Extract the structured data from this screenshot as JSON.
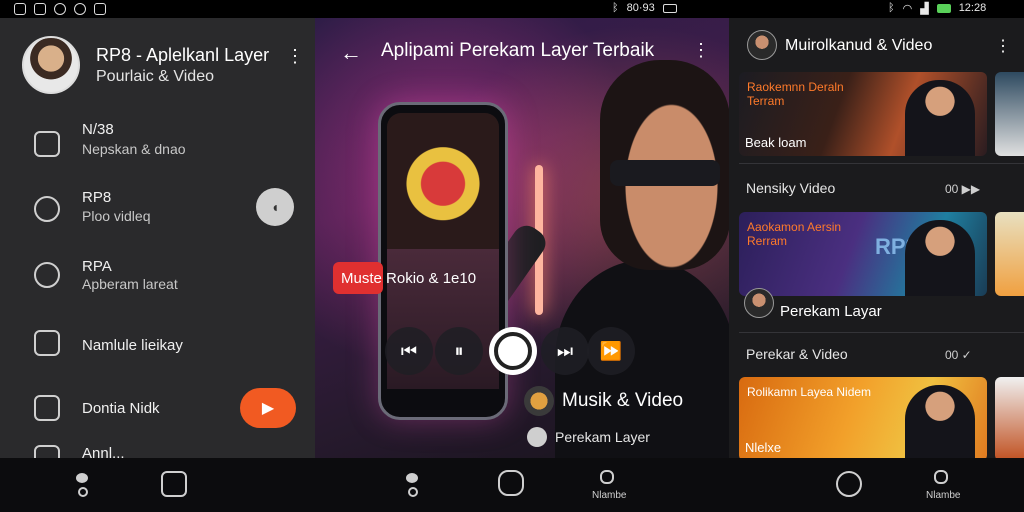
{
  "status_bar": {
    "time_mid": "80·93",
    "time_right": "12:28"
  },
  "left_panel": {
    "title": "RP8 - Aplelkanl Layer",
    "subtitle": "Pourlaic & Video",
    "more_icon": "more-vertical-icon",
    "items": [
      {
        "line1": "N/38",
        "line2": "Nepskan & dnao",
        "icon": "lock-icon"
      },
      {
        "line1": "RP8",
        "line2": "Ploo vidleq",
        "icon": "shield-icon"
      },
      {
        "line1": "RPA",
        "line2": "Apberam lareat",
        "icon": "target-icon"
      },
      {
        "line1": "Namlule lieikay",
        "line2": "",
        "icon": "calendar-icon"
      },
      {
        "line1": "Dontia Nidk",
        "line2": "",
        "icon": "camera-icon"
      },
      {
        "line1": "Annl...",
        "line2": "",
        "icon": "check-icon"
      }
    ],
    "round_button_glyph": "◖",
    "play_button_glyph": "▶"
  },
  "middle_panel": {
    "title": "Aplipami Perekam Layer Terbaik",
    "back_glyph": "←",
    "song_chip": "Muste Rokio & 1e10",
    "controls": {
      "prev": "⏮",
      "pause": "⏸",
      "next": "⏭",
      "fast_forward": "⏩"
    },
    "badge1": "Musik & Video",
    "badge2": "Perekam Layer"
  },
  "right_panel": {
    "title": "Muirolkanud & Video",
    "card1": {
      "headline": "Raokemnn Deraln Terram",
      "caption": "Beak loam"
    },
    "section1": {
      "label": "Nensiky Video",
      "extra": "00 ▶▶"
    },
    "card2": {
      "headline": "Aaokamon Aersin Rerram",
      "badge": "RP8"
    },
    "row_label": "Perekam Layar",
    "section2": {
      "label": "Perekar & Video",
      "extra": "00 ✓"
    },
    "card3": {
      "headline": "Rolikamn Layea Nidem",
      "caption": "Nlelxe"
    }
  },
  "bottom_nav": {
    "labels": [
      "Nlambe",
      "Nlambe"
    ]
  },
  "colors": {
    "accent_orange": "#f15a22",
    "accent_red": "#e03030",
    "panel_dark": "#2a2a2c"
  }
}
